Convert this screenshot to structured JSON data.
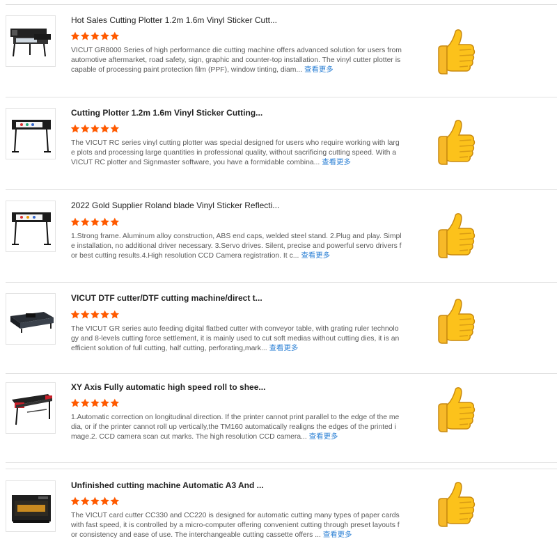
{
  "colors": {
    "star": "#ff5a00",
    "more_link": "#2a7fd4",
    "divider": "#e0e0e0"
  },
  "products": [
    {
      "title": "Hot Sales Cutting Plotter 1.2m 1.6m Vinyl Sticker Cutt...",
      "rating": 5,
      "image": "cutting-plotter-dual-image",
      "description": "VICUT GR8000 Series of high performance die cutting machine offers advanced solution for users from automotive aftermarket, road safety, sign, graphic and counter-top installation. The vinyl cutter plotter is capable of processing paint protection film (PPF), window tinting, diam...",
      "more_label": "查看更多",
      "like_icon": "thumbs-up-icon"
    },
    {
      "title": "Cutting Plotter 1.2m 1.6m Vinyl Sticker Cutting...",
      "rating": 5,
      "image": "cutting-plotter-stand-image",
      "description": "The VICUT RC series vinyl cutting plotter was special designed for users who require working with large plots and processing large quantities in professional quality, without sacrificing cutting speed. With a VICUT RC plotter and Signmaster software, you have a formidable combina...",
      "more_label": "查看更多",
      "like_icon": "thumbs-up-icon"
    },
    {
      "title": "2022 Gold Supplier Roland blade Vinyl Sticker Reflecti...",
      "rating": 5,
      "image": "vinyl-cutter-stand-image",
      "description": "1.Strong frame. Aluminum alloy construction, ABS end caps, welded steel stand. 2.Plug and play. Simple installation, no additional driver necessary. 3.Servo drives. Silent, precise and powerful servo drivers for best cutting results.4.High resolution CCD Camera registration. It c...",
      "more_label": "查看更多",
      "like_icon": "thumbs-up-icon"
    },
    {
      "title": "VICUT DTF cutter/DTF cutting machine/direct t...",
      "rating": 5,
      "image": "flatbed-cutter-image",
      "description": "The VICUT GR series auto feeding digital flatbed cutter with conveyor table, with grating ruler technology and 8-levels cutting force settlement, it is mainly used to cut soft medias without cutting dies, it is an efficient solution of full cutting, half cutting, perforating,mark...",
      "more_label": "查看更多",
      "like_icon": "thumbs-up-icon"
    },
    {
      "title": "XY Axis Fully automatic high speed roll to shee...",
      "rating": 5,
      "image": "roll-cutter-image",
      "description": "1.Automatic correction on longitudinal direction. If the printer cannot print parallel to the edge of the media, or if the printer cannot roll up vertically,the TM160 automatically realigns the edges of the printed image.2. CCD camera scan cut marks. The high resolution CCD camera...",
      "more_label": "查看更多",
      "like_icon": "thumbs-up-icon"
    },
    {
      "title": "Unfinished cutting machine Automatic A3 And ...",
      "rating": 5,
      "image": "card-cutter-image",
      "description": "The VICUT card cutter CC330 and CC220 is designed for automatic cutting many types of paper cards with fast speed, it is controlled by a micro-computer offering convenient cutting through preset layouts for consistency and ease of use. The interchangeable cutting cassette offers ...",
      "more_label": "查看更多",
      "like_icon": "thumbs-up-icon"
    }
  ]
}
